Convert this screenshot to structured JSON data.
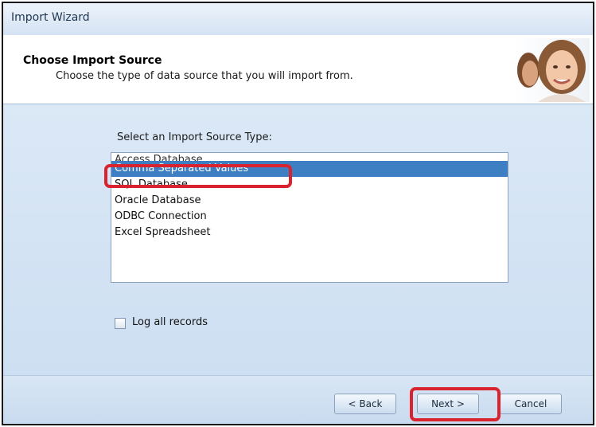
{
  "window": {
    "title": "Import Wizard"
  },
  "header": {
    "title": "Choose Import Source",
    "description": "Choose the type of data source that you will import from."
  },
  "source_list": {
    "label": "Select an Import Source Type:",
    "items": [
      {
        "label": "Access Database"
      },
      {
        "label": "Comma Separated Values",
        "selected": true
      },
      {
        "label": "SQL Database"
      },
      {
        "label": "Oracle Database"
      },
      {
        "label": "ODBC Connection"
      },
      {
        "label": "Excel Spreadsheet"
      }
    ]
  },
  "options": {
    "log_all_records": {
      "label": "Log all records",
      "checked": false
    }
  },
  "buttons": {
    "back": "< Back",
    "next": "Next >",
    "cancel": "Cancel"
  },
  "colors": {
    "selection": "#3d7fc2",
    "highlight": "#d9232e"
  }
}
